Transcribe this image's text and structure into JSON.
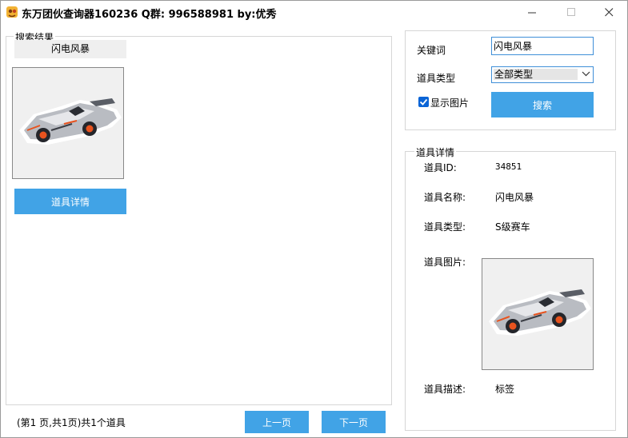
{
  "window": {
    "title": "东万团伙查询器160236  Q群: 996588981 by:优秀"
  },
  "results": {
    "legend": "搜索结果",
    "item_name": "闪电风暴",
    "detail_button": "道具详情",
    "pagination_text": "(第1 页,共1页)共1个道具",
    "prev_button": "上一页",
    "next_button": "下一页"
  },
  "search": {
    "keyword_label": "关键词",
    "keyword_value": "闪电风暴",
    "type_label": "道具类型",
    "type_value": "全部类型",
    "show_image_label": "显示图片",
    "show_image_checked": true,
    "search_button": "搜索"
  },
  "details": {
    "legend": "道具详情",
    "id_label": "道具ID:",
    "id_value": "34851",
    "name_label": "道具名称:",
    "name_value": "闪电风暴",
    "type_label": "道具类型:",
    "type_value": "S级赛车",
    "image_label": "道具图片:",
    "desc_label": "道具描述:",
    "desc_value": "标签"
  },
  "colors": {
    "accent": "#41a3e6",
    "input_border": "#3f8fd8",
    "checkbox": "#0a64d6"
  },
  "icons": {
    "app": "app-logo-icon",
    "minimize": "minimize-icon",
    "maximize": "maximize-icon",
    "close": "close-icon",
    "dropdown": "chevron-down-icon",
    "check": "checkmark-icon"
  }
}
